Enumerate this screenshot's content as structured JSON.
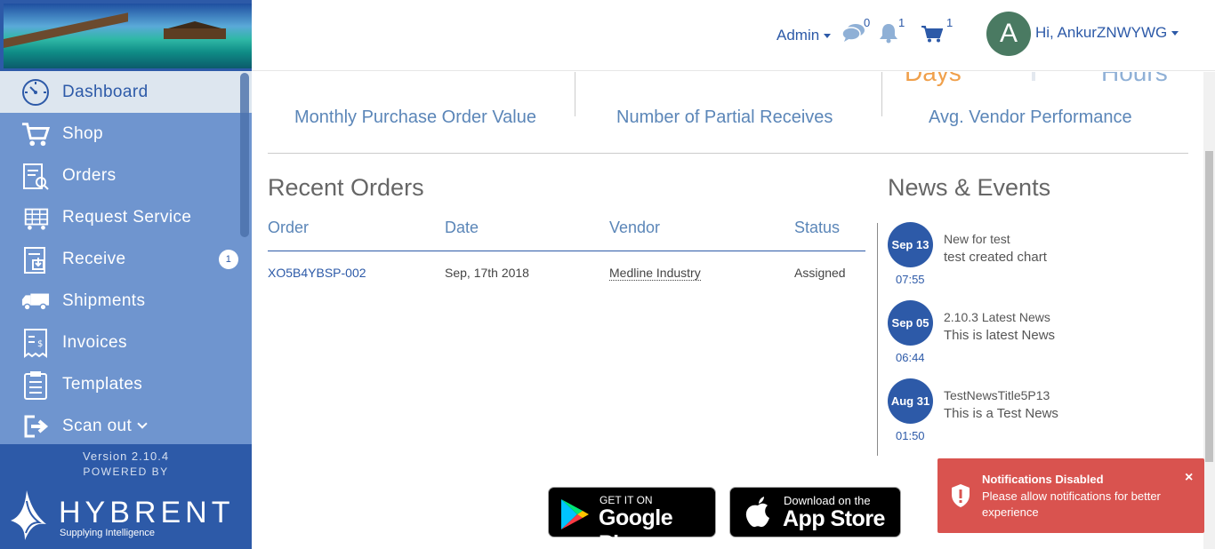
{
  "sidebar": {
    "items": [
      {
        "label": "Dashboard",
        "icon": "dashboard-icon"
      },
      {
        "label": "Shop",
        "icon": "cart-icon"
      },
      {
        "label": "Orders",
        "icon": "orders-icon"
      },
      {
        "label": "Request Service",
        "icon": "request-service-icon"
      },
      {
        "label": "Receive",
        "icon": "receive-icon",
        "badge": "1"
      },
      {
        "label": "Shipments",
        "icon": "truck-icon"
      },
      {
        "label": "Invoices",
        "icon": "invoice-icon"
      },
      {
        "label": "Templates",
        "icon": "templates-icon"
      },
      {
        "label": "Scan out",
        "icon": "scan-out-icon"
      }
    ],
    "version": "Version 2.10.4",
    "powered_by": "POWERED BY",
    "brand_name": "HYBRENT",
    "brand_tagline": "Supplying Intelligence"
  },
  "header": {
    "admin_label": "Admin",
    "messages_count": "0",
    "notifications_count": "1",
    "cart_count": "1",
    "avatar_letter": "A",
    "greeting": "Hi, AnkurZNWYWG"
  },
  "stats": {
    "days_label": "Days",
    "hours_label": "Hours",
    "monthly_po_label": "Monthly Purchase Order Value",
    "partial_receives_label": "Number of Partial Receives",
    "vendor_perf_label": "Avg. Vendor Performance"
  },
  "recent_orders": {
    "title": "Recent Orders",
    "columns": [
      "Order",
      "Date",
      "Vendor",
      "Status"
    ],
    "rows": [
      {
        "order": "XO5B4YBSP-002",
        "date": "Sep, 17th 2018",
        "vendor": "Medline Industry",
        "status": "Assigned"
      }
    ]
  },
  "news": {
    "title": "News & Events",
    "items": [
      {
        "date": "Sep 13",
        "time": "07:55",
        "title": "New for test",
        "desc": "test created chart"
      },
      {
        "date": "Sep 05",
        "time": "06:44",
        "title": "2.10.3 Latest News",
        "desc": "This is latest News"
      },
      {
        "date": "Aug 31",
        "time": "01:50",
        "title": "TestNewsTitle5P13",
        "desc": "This is a Test News"
      }
    ]
  },
  "stores": {
    "google_small": "GET IT ON",
    "google_big": "Google Play",
    "apple_small": "Download on the",
    "apple_big": "App Store"
  },
  "toast": {
    "title": "Notifications Disabled",
    "message": "Please allow notifications for better experience",
    "close": "×"
  },
  "colors": {
    "brand": "#2d5aa8",
    "nav_bg": "#6f95cf",
    "accent_orange": "#f0a04b",
    "toast_red": "#d9534f"
  }
}
